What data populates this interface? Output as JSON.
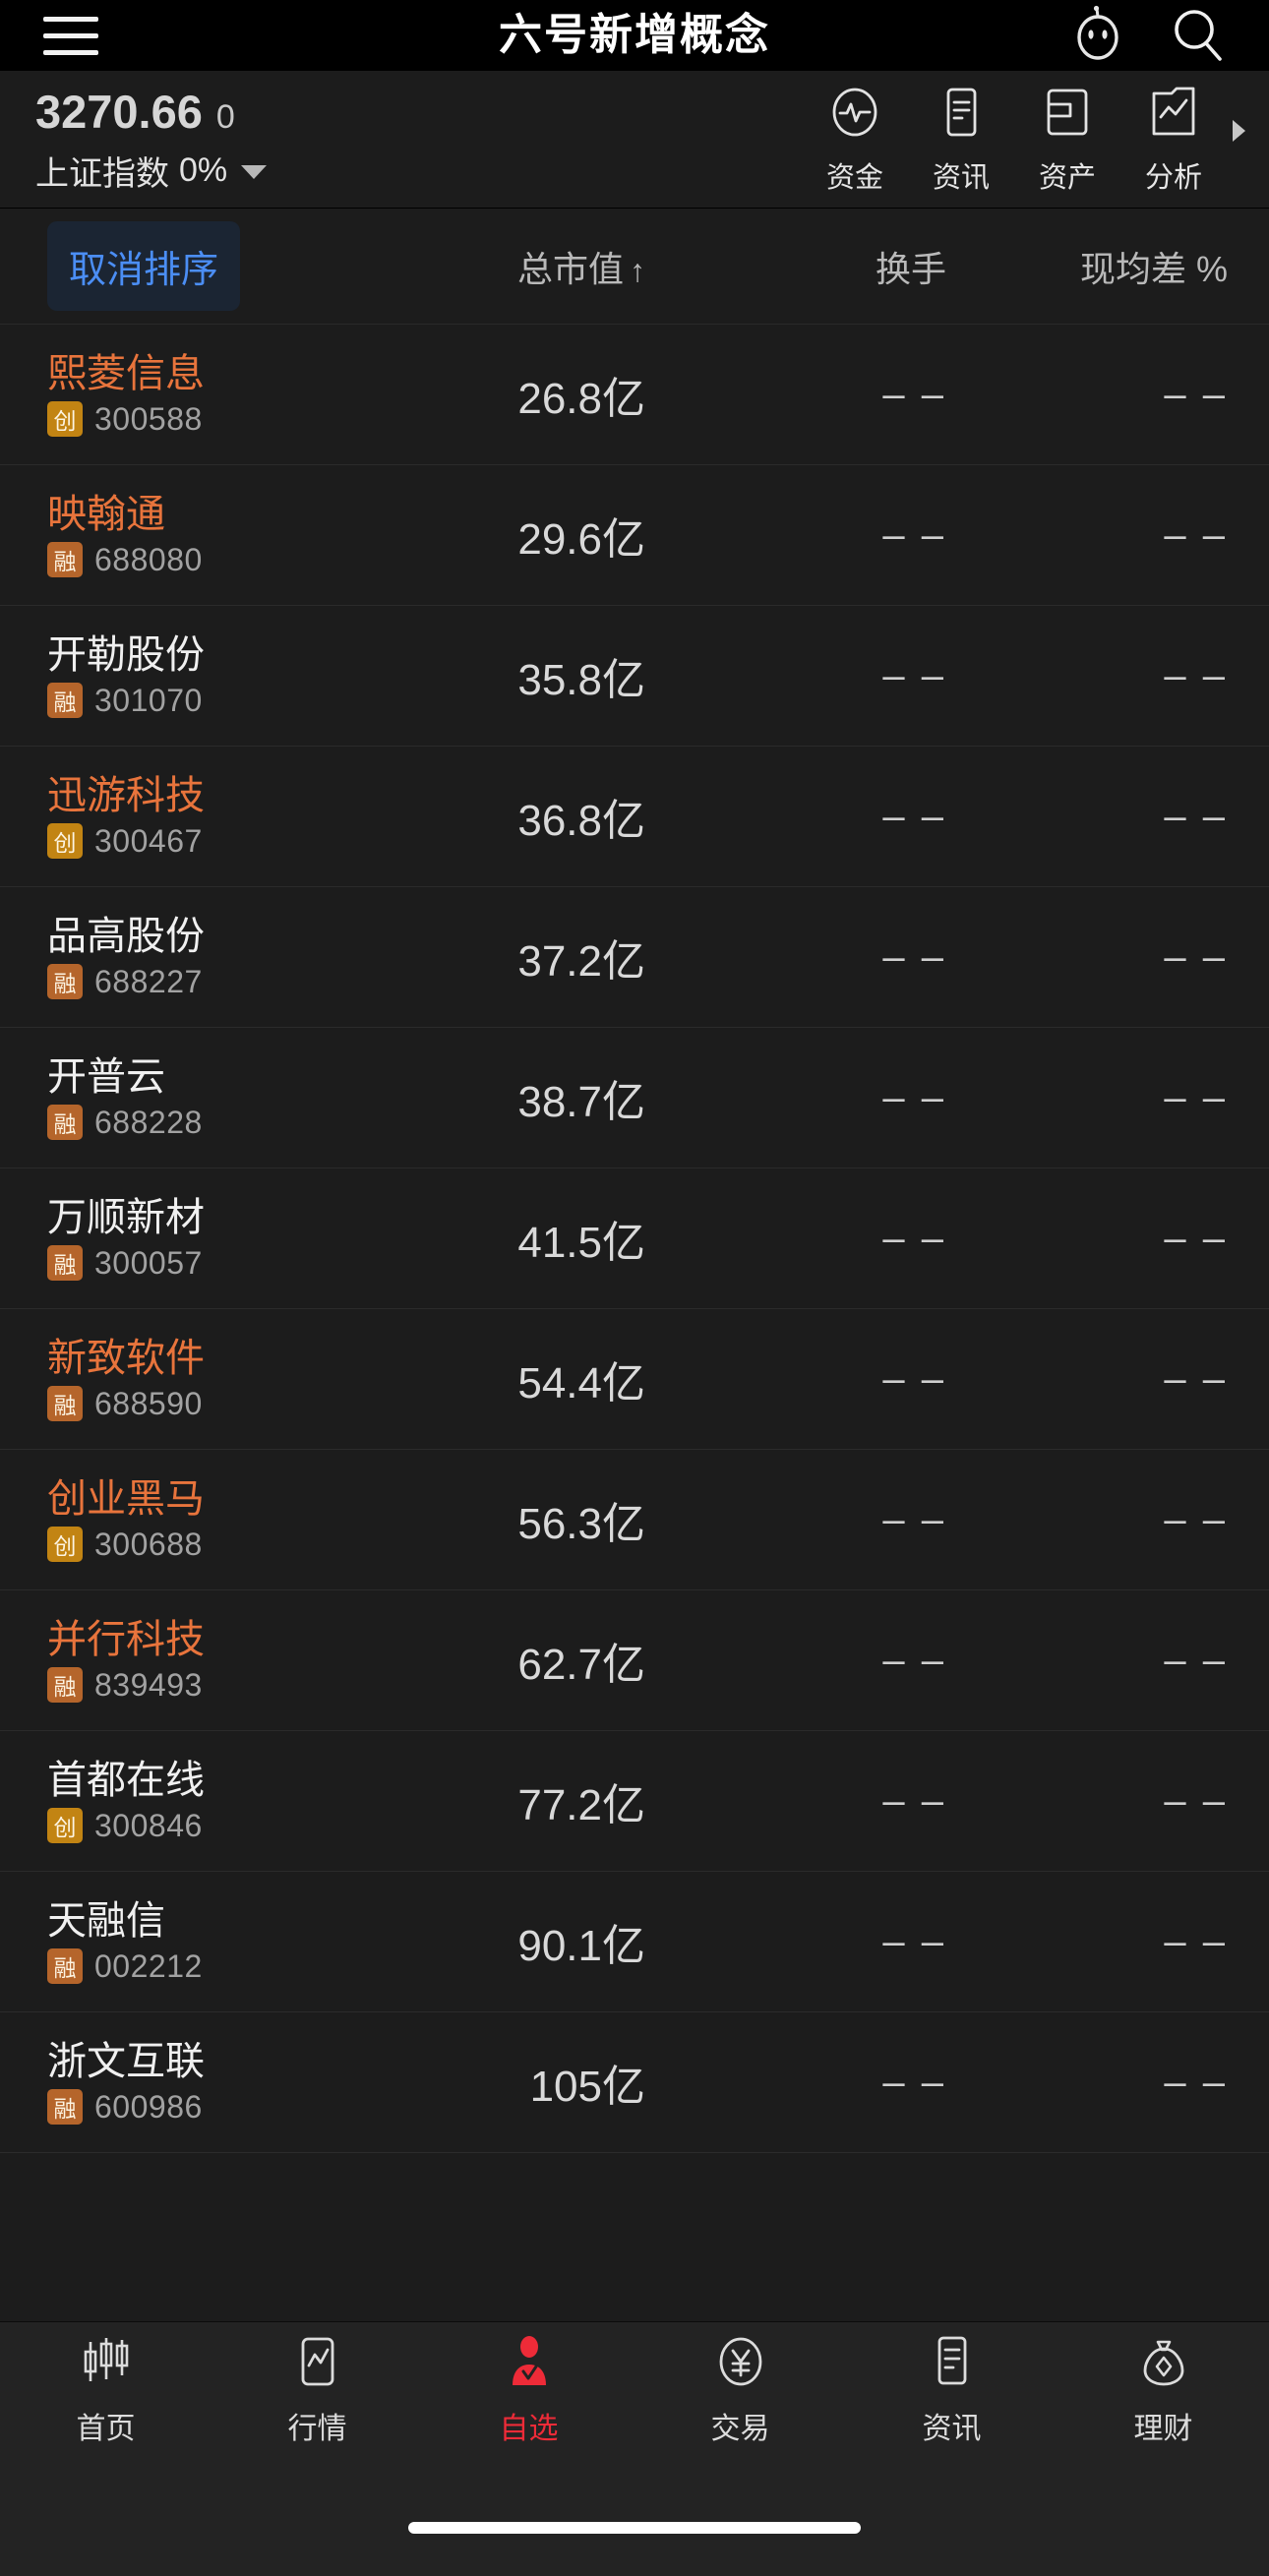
{
  "topbar": {
    "menu_icon": "hamburger-icon",
    "title": "六号新增概念",
    "robot_icon": "robot-icon",
    "search_icon": "search-icon"
  },
  "index_bar": {
    "value": "3270.66",
    "change": "0",
    "name": "上证指数",
    "percent": "0%",
    "dropdown_icon": "chevron-down-icon",
    "quick_actions": [
      {
        "label": "资金",
        "icon": "pulse-circle-icon"
      },
      {
        "label": "资讯",
        "icon": "news-document-icon"
      },
      {
        "label": "资产",
        "icon": "wallet-icon"
      },
      {
        "label": "分析",
        "icon": "analysis-folder-icon"
      }
    ],
    "more_arrow_icon": "chevron-right-icon"
  },
  "table": {
    "cancel_sort_label": "取消排序",
    "columns": [
      {
        "key": "cap",
        "label": "总市值",
        "sort": "↑"
      },
      {
        "key": "turnover",
        "label": "换手",
        "sort": ""
      },
      {
        "key": "diff",
        "label": "现均差 %",
        "sort": ""
      }
    ],
    "rows": [
      {
        "name": "熙菱信息",
        "name_color": "up",
        "badge": "创",
        "badge_type": "chuang",
        "code": "300588",
        "cap": "26.8亿",
        "turnover": "– –",
        "diff": "– –"
      },
      {
        "name": "映翰通",
        "name_color": "up",
        "badge": "融",
        "badge_type": "rong",
        "code": "688080",
        "cap": "29.6亿",
        "turnover": "– –",
        "diff": "– –"
      },
      {
        "name": "开勒股份",
        "name_color": "flat",
        "badge": "融",
        "badge_type": "rong",
        "code": "301070",
        "cap": "35.8亿",
        "turnover": "– –",
        "diff": "– –"
      },
      {
        "name": "迅游科技",
        "name_color": "up",
        "badge": "创",
        "badge_type": "chuang",
        "code": "300467",
        "cap": "36.8亿",
        "turnover": "– –",
        "diff": "– –"
      },
      {
        "name": "品高股份",
        "name_color": "flat",
        "badge": "融",
        "badge_type": "rong",
        "code": "688227",
        "cap": "37.2亿",
        "turnover": "– –",
        "diff": "– –"
      },
      {
        "name": "开普云",
        "name_color": "flat",
        "badge": "融",
        "badge_type": "rong",
        "code": "688228",
        "cap": "38.7亿",
        "turnover": "– –",
        "diff": "– –"
      },
      {
        "name": "万顺新材",
        "name_color": "flat",
        "badge": "融",
        "badge_type": "rong",
        "code": "300057",
        "cap": "41.5亿",
        "turnover": "– –",
        "diff": "– –"
      },
      {
        "name": "新致软件",
        "name_color": "up",
        "badge": "融",
        "badge_type": "rong",
        "code": "688590",
        "cap": "54.4亿",
        "turnover": "– –",
        "diff": "– –"
      },
      {
        "name": "创业黑马",
        "name_color": "up",
        "badge": "创",
        "badge_type": "chuang",
        "code": "300688",
        "cap": "56.3亿",
        "turnover": "– –",
        "diff": "– –"
      },
      {
        "name": "并行科技",
        "name_color": "up",
        "badge": "融",
        "badge_type": "rong",
        "code": "839493",
        "cap": "62.7亿",
        "turnover": "– –",
        "diff": "– –"
      },
      {
        "name": "首都在线",
        "name_color": "flat",
        "badge": "创",
        "badge_type": "chuang",
        "code": "300846",
        "cap": "77.2亿",
        "turnover": "– –",
        "diff": "– –"
      },
      {
        "name": "天融信",
        "name_color": "flat",
        "badge": "融",
        "badge_type": "rong",
        "code": "002212",
        "cap": "90.1亿",
        "turnover": "– –",
        "diff": "– –"
      },
      {
        "name": "浙文互联",
        "name_color": "flat",
        "badge": "融",
        "badge_type": "rong",
        "code": "600986",
        "cap": "105亿",
        "turnover": "– –",
        "diff": "– –"
      }
    ]
  },
  "tabbar": {
    "active_index": 2,
    "items": [
      {
        "label": "首页",
        "icon": "candlestick-icon"
      },
      {
        "label": "行情",
        "icon": "market-chart-icon"
      },
      {
        "label": "自选",
        "icon": "person-check-icon"
      },
      {
        "label": "交易",
        "icon": "yuan-circle-icon"
      },
      {
        "label": "资讯",
        "icon": "news-document-icon"
      },
      {
        "label": "理财",
        "icon": "money-bag-icon"
      }
    ]
  },
  "colors": {
    "accent_red": "#ee2b38",
    "up_orange": "#e8743c",
    "link_blue": "#4b8ef5",
    "badge_chuang": "#c28413",
    "badge_rong": "#b5652b",
    "background": "#1c1c1c"
  }
}
